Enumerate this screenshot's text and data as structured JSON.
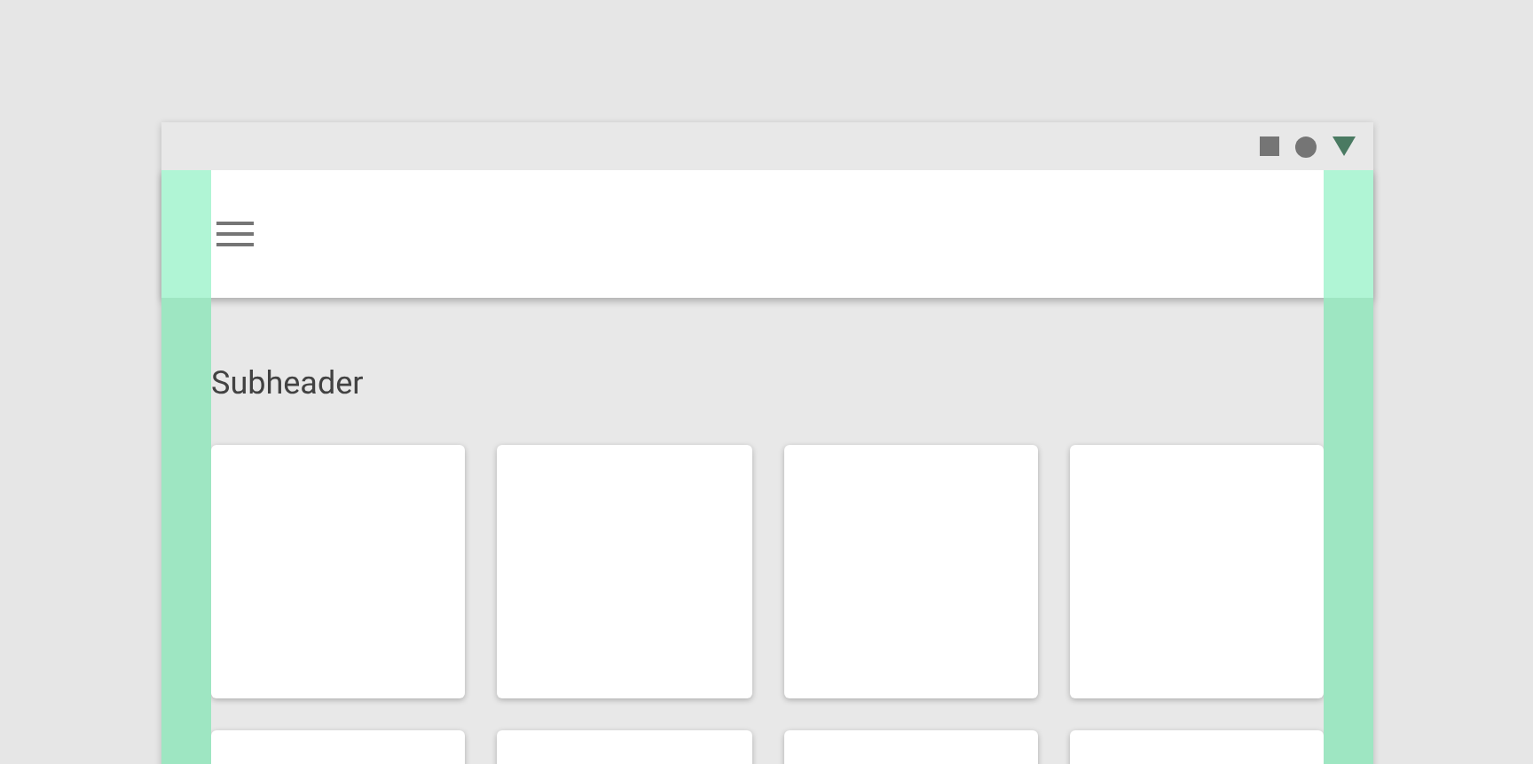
{
  "subheader": "Subheader",
  "cards": [
    {
      "kind": "blank"
    },
    {
      "kind": "blank"
    },
    {
      "kind": "blank"
    },
    {
      "kind": "blank"
    },
    {
      "kind": "blank"
    },
    {
      "kind": "blank"
    },
    {
      "kind": "blank"
    },
    {
      "kind": "blank"
    }
  ]
}
